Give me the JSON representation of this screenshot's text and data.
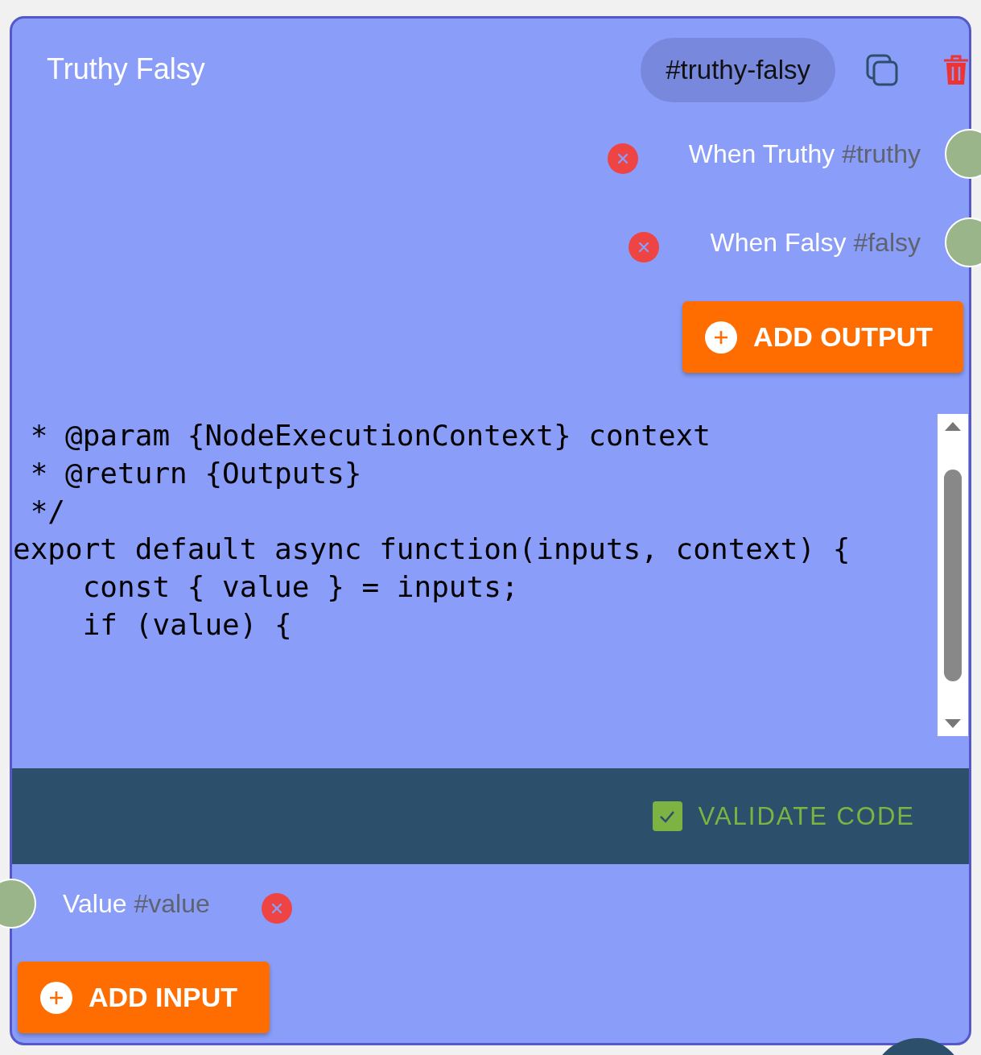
{
  "node": {
    "title": "Truthy Falsy",
    "id_badge": "#truthy-falsy"
  },
  "outputs": [
    {
      "label": "When Truthy",
      "tag": "#truthy"
    },
    {
      "label": "When Falsy",
      "tag": "#falsy"
    }
  ],
  "add_output_button": "ADD OUTPUT",
  "code_lines": [
    " * @param {NodeExecutionContext} context",
    " * @return {Outputs}",
    " */",
    "export default async function(inputs, context) {",
    "    const { value } = inputs;",
    "    if (value) {"
  ],
  "validate": {
    "label": "VALIDATE CODE",
    "checked": true
  },
  "inputs": [
    {
      "label": "Value",
      "tag": "#value"
    }
  ],
  "add_input_button": "ADD INPUT"
}
